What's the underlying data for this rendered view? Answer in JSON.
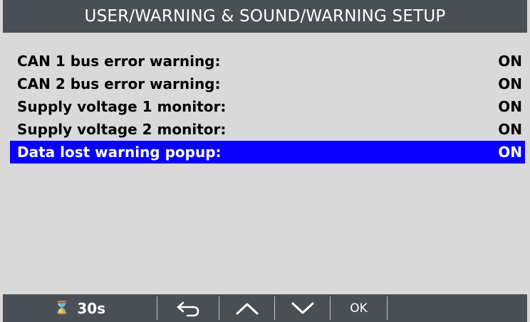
{
  "header": {
    "title": "USER/WARNING & SOUND/WARNING SETUP"
  },
  "menu": {
    "items": [
      {
        "label": "CAN 1 bus error warning:",
        "value": "ON",
        "selected": false
      },
      {
        "label": "CAN 2 bus error warning:",
        "value": "ON",
        "selected": false
      },
      {
        "label": "Supply voltage 1 monitor:",
        "value": "ON",
        "selected": false
      },
      {
        "label": "Supply voltage 2 monitor:",
        "value": "ON",
        "selected": false
      },
      {
        "label": "Data lost warning popup:",
        "value": "ON",
        "selected": true
      }
    ]
  },
  "footer": {
    "timer_icon": "hourglass-icon",
    "timer_value": "30s",
    "back_icon": "back-arrow-icon",
    "up_icon": "chevron-up-icon",
    "down_icon": "chevron-down-icon",
    "ok_label": "OK"
  },
  "colors": {
    "title_bar": "#4a4f56",
    "background": "#d9d9d9",
    "selection": "#0a00ff"
  }
}
